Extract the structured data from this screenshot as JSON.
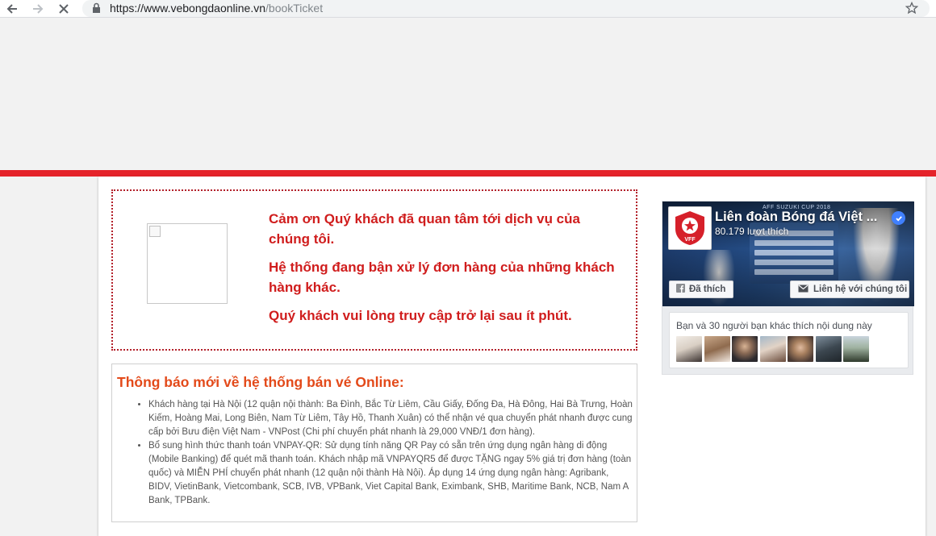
{
  "browser": {
    "url_host": "https://www.vebongdaonline.vn",
    "url_path": "/bookTicket",
    "icons": [
      "back-arrow-icon",
      "forward-arrow-icon",
      "stop-loading-icon",
      "lock-icon",
      "bookmark-star-icon"
    ]
  },
  "colors": {
    "accent_red": "#e5232a",
    "notice_text": "#d01d1d",
    "announce_title": "#e34a1a",
    "fb_blue": "#4080ff"
  },
  "notice": {
    "lines": [
      "Cảm ơn Quý khách đã quan tâm tới dịch vụ của chúng tôi.",
      "Hệ thống đang bận xử lý đơn hàng của những khách hàng khác.",
      "Quý khách vui lòng truy cập trở lại sau ít phút."
    ]
  },
  "announcement": {
    "title": "Thông báo mới về hệ thống bán vé Online:",
    "items": [
      "Khách hàng tại Hà Nội (12 quận nội thành: Ba Đình, Bắc Từ Liêm, Cầu Giấy, Đống Đa, Hà Đông, Hai Bà Trưng, Hoàn Kiếm, Hoàng Mai, Long Biên, Nam Từ Liêm, Tây Hồ, Thanh Xuân) có thể nhận vé qua chuyển phát nhanh được cung cấp bởi Bưu điện Việt Nam - VNPost (Chi phí chuyển phát nhanh là 29,000 VNĐ/1 đơn hàng).",
      "Bổ sung hình thức thanh toán VNPAY-QR: Sử dụng tính năng QR Pay có sẵn trên ứng dụng ngân hàng di động (Mobile Banking) để quét mã thanh toán. Khách nhập mã VNPAYQR5 để được TẶNG ngay 5% giá trị đơn hàng (toàn quốc) và MIỄN PHÍ chuyển phát nhanh (12 quận nội thành Hà Nội). Áp dụng 14 ứng dụng ngân hàng: Agribank, BIDV, VietinBank, Vietcombank, SCB, IVB, VPBank, Viet Capital Bank, Eximbank, SHB, Maritime Bank, NCB, Nam A Bank, TPBank."
    ]
  },
  "facebook_widget": {
    "page_name": "Liên đoàn Bóng đá Việt ...",
    "likes": "80.179 lượt thích",
    "like_button": "Đã thích",
    "contact_button": "Liên hệ với chúng tôi",
    "friends_text": "Bạn và 30 người bạn khác thích nội dung này",
    "cover_caption": "AFF SUZUKI CUP 2018",
    "logo_text": "VFF",
    "friend_avatar_count": 7
  }
}
